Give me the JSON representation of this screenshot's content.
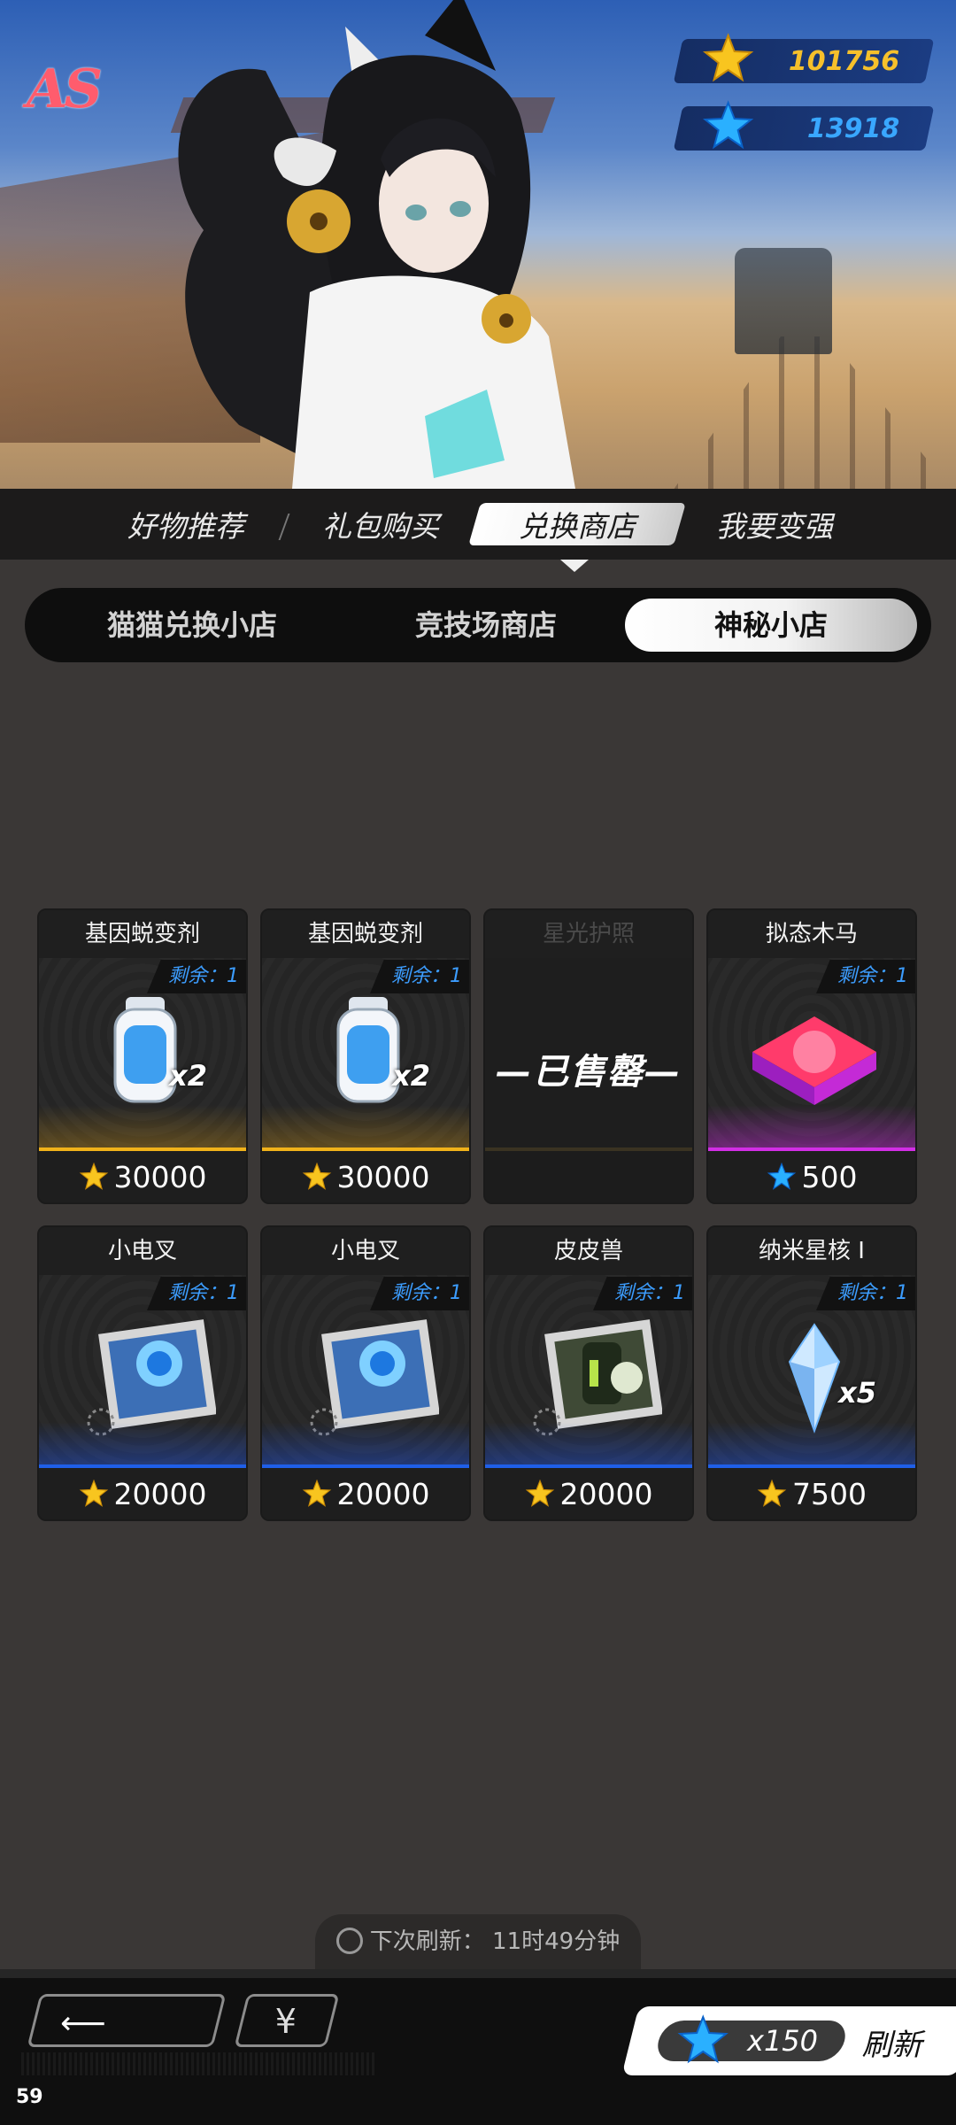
{
  "header": {
    "logo_text": "AS",
    "currencies": [
      {
        "icon": "gold-star-icon",
        "value": "101756",
        "color": "#f6c02b"
      },
      {
        "icon": "blue-star-icon",
        "value": "13918",
        "color": "#39a7ff"
      }
    ]
  },
  "main_tabs": [
    {
      "label": "好物推荐",
      "active": false
    },
    {
      "label": "礼包购买",
      "active": false
    },
    {
      "label": "兑换商店",
      "active": true
    },
    {
      "label": "我要变强",
      "active": false
    }
  ],
  "sub_tabs": [
    {
      "label": "猫猫兑换小店",
      "active": false
    },
    {
      "label": "竞技场商店",
      "active": false
    },
    {
      "label": "神秘小店",
      "active": true
    }
  ],
  "items": [
    {
      "name": "基因蜕变剂",
      "remaining": "剩余：1",
      "qty": "x2",
      "price": "30000",
      "currency": "gold",
      "tier": "gold",
      "icon": "serum-bottle-icon"
    },
    {
      "name": "基因蜕变剂",
      "remaining": "剩余：1",
      "qty": "x2",
      "price": "30000",
      "currency": "gold",
      "tier": "gold",
      "icon": "serum-bottle-icon"
    },
    {
      "name": "星光护照",
      "sold_out_label": "—已售罄—",
      "sold": true,
      "icon": "passport-icon"
    },
    {
      "name": "拟态木马",
      "remaining": "剩余：1",
      "qty": "",
      "price": "500",
      "currency": "blue",
      "tier": "purple",
      "icon": "mimic-trojan-icon"
    },
    {
      "name": "小电叉",
      "remaining": "剩余：1",
      "qty": "",
      "price": "20000",
      "currency": "gold",
      "tier": "blue",
      "icon": "robot-card-icon"
    },
    {
      "name": "小电叉",
      "remaining": "剩余：1",
      "qty": "",
      "price": "20000",
      "currency": "gold",
      "tier": "blue",
      "icon": "robot-card-icon"
    },
    {
      "name": "皮皮兽",
      "remaining": "剩余：1",
      "qty": "",
      "price": "20000",
      "currency": "gold",
      "tier": "blue",
      "icon": "beast-card-icon"
    },
    {
      "name": "纳米星核 I",
      "remaining": "剩余：1",
      "qty": "x5",
      "price": "7500",
      "currency": "gold",
      "tier": "blue",
      "icon": "crystal-icon"
    }
  ],
  "refresh_timer": {
    "label": "下次刷新：",
    "value": "11时49分钟"
  },
  "bottom": {
    "back_icon": "back-arrow-icon",
    "yen_label": "¥",
    "refresh_cost": "x150",
    "refresh_label": "刷新"
  },
  "fps": "59",
  "colors": {
    "gold": "#f0b21a",
    "purple": "#d22ee5",
    "blue": "#1f5fe8",
    "remaining_text": "#3c9dff"
  }
}
